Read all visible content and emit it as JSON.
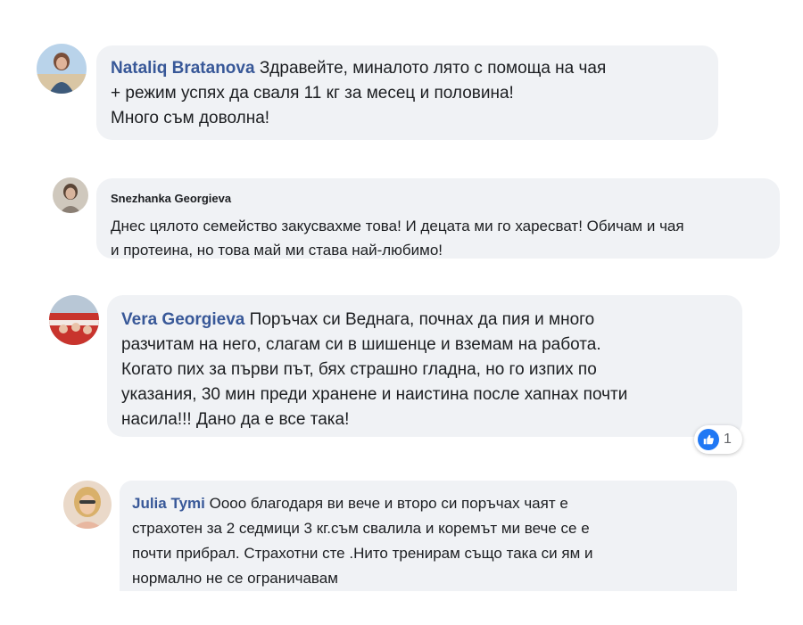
{
  "colors": {
    "bubble": "#f0f2f5",
    "author": "#385898",
    "like": "#2078f4",
    "text": "#1c1e21"
  },
  "comments": [
    {
      "author": "Nataliq Bratanova",
      "lines": [
        "Здравейте, миналото лято с помоща на чая",
        "+ режим успях да сваля 11 кг за месец и половина!",
        "Много съм доволна!"
      ]
    },
    {
      "author": "Snezhanka Georgieva",
      "lines": [
        "Днес цялото семейство закусвахме това! И децата ми го харесват! Обичам и чая",
        "и протеина, но това май ми става най-любимо!"
      ]
    },
    {
      "author": "Vera Georgieva",
      "lines": [
        "Поръчах си Веднага, почнах да пия и много",
        "разчитам на него, слагам си в шишенце и вземам на работа.",
        "Когато пих за първи път, бях страшно гладна, но го изпих по",
        "указания, 30 мин преди хранене и наистина после хапнах почти",
        "насила!!! Дано да е все така!"
      ],
      "reaction": {
        "icon": "like-icon",
        "count": "1"
      }
    },
    {
      "author": "Julia Tymi",
      "lines": [
        "Оооо благодаря ви вече и второ си поръчах чаят е",
        "страхотен за 2 седмици 3 кг.съм свалила и коремът ми вече се е",
        "почти прибрал. Страхотни сте .Нито тренирам също така си ям и",
        "нормално не се ограничавам"
      ]
    }
  ]
}
